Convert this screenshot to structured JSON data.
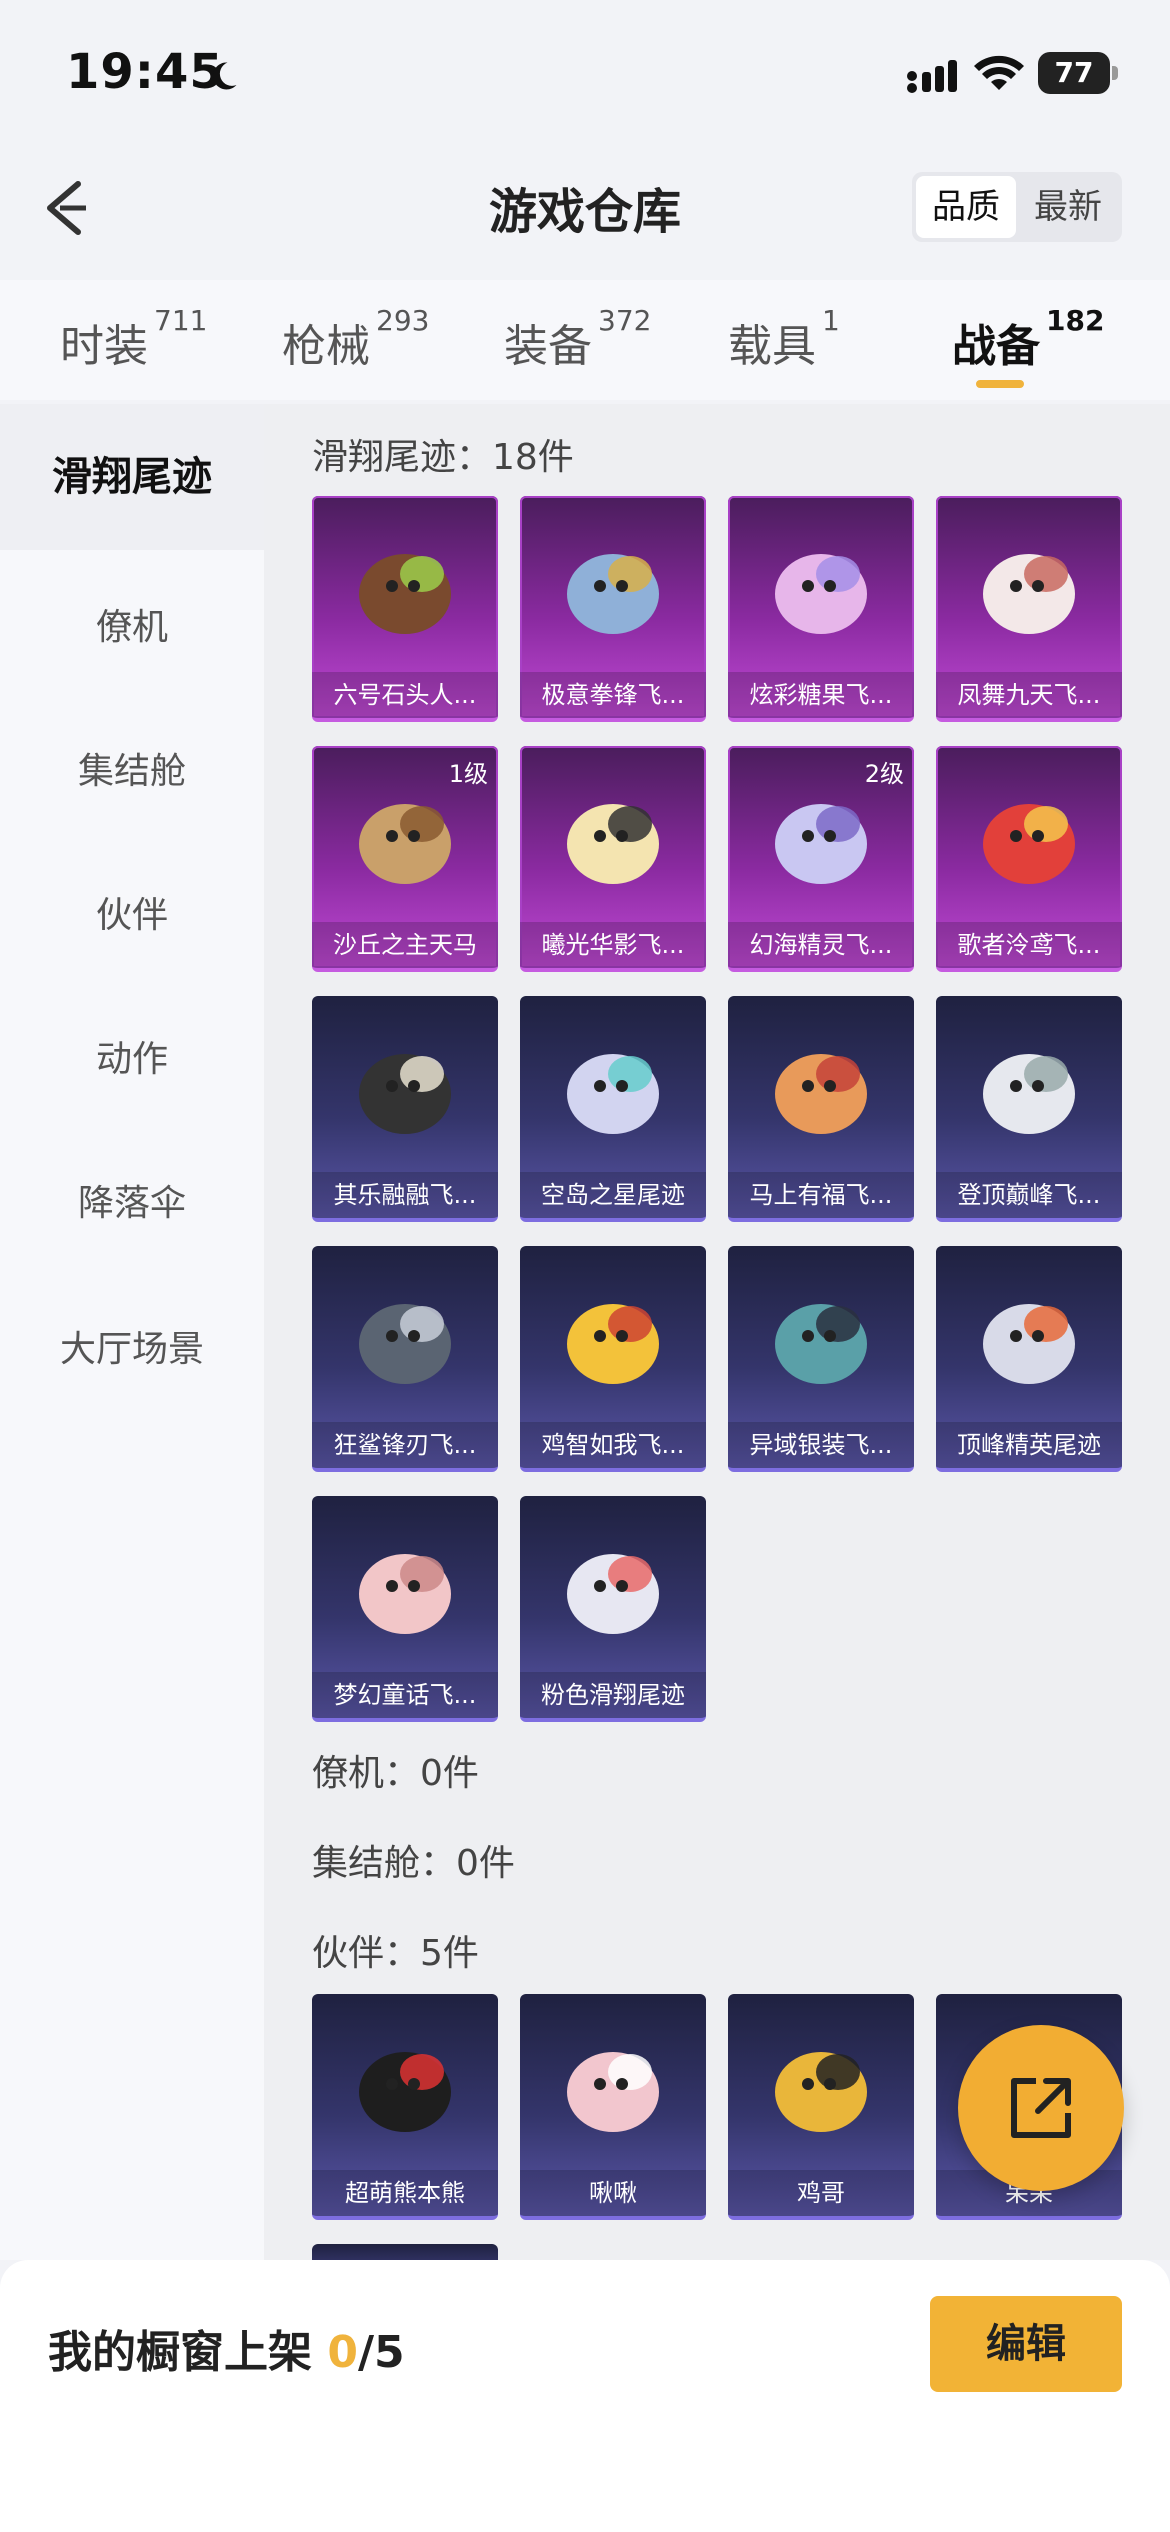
{
  "status": {
    "time": "19:45",
    "battery": "77"
  },
  "header": {
    "title": "游戏仓库",
    "sort": {
      "active": "品质",
      "other": "最新"
    }
  },
  "tabs": [
    {
      "label": "时装",
      "count": "711"
    },
    {
      "label": "枪械",
      "count": "293"
    },
    {
      "label": "装备",
      "count": "372"
    },
    {
      "label": "载具",
      "count": "1"
    },
    {
      "label": "战备",
      "count": "182"
    }
  ],
  "sidebar": {
    "items": [
      "滑翔尾迹",
      "僚机",
      "集结舱",
      "伙伴",
      "动作",
      "降落伞",
      "大厅场景"
    ]
  },
  "sections": {
    "glide": {
      "title": "滑翔尾迹：18件",
      "items": [
        {
          "name": "六号石头人...",
          "tier": "purple",
          "icon": "stone-sprout-icon",
          "level": ""
        },
        {
          "name": "极意拳锋飞...",
          "tier": "purple",
          "icon": "elephant-boxer-icon",
          "level": ""
        },
        {
          "name": "炫彩糖果飞...",
          "tier": "purple",
          "icon": "candy-icon",
          "level": ""
        },
        {
          "name": "凤舞九天飞...",
          "tier": "purple",
          "icon": "phoenix-icon",
          "level": ""
        },
        {
          "name": "沙丘之主天马",
          "tier": "purple",
          "icon": "pegasus-icon",
          "level": "1级"
        },
        {
          "name": "曦光华影飞...",
          "tier": "purple",
          "icon": "flower-icon",
          "level": ""
        },
        {
          "name": "幻海精灵飞...",
          "tier": "purple",
          "icon": "jellyfish-icon",
          "level": "2级"
        },
        {
          "name": "歌者泠鸢飞...",
          "tier": "purple",
          "icon": "bird-icon",
          "level": ""
        },
        {
          "name": "其乐融融飞...",
          "tier": "blue",
          "icon": "penguin-icon",
          "level": ""
        },
        {
          "name": "空岛之星尾迹",
          "tier": "blue",
          "icon": "rainbow-trail-icon",
          "level": ""
        },
        {
          "name": "马上有福飞...",
          "tier": "blue",
          "icon": "horse-toy-icon",
          "level": ""
        },
        {
          "name": "登顶巅峰飞...",
          "tier": "blue",
          "icon": "jet-icon",
          "level": ""
        },
        {
          "name": "狂鲨锋刃飞...",
          "tier": "blue",
          "icon": "shark-icon",
          "level": ""
        },
        {
          "name": "鸡智如我飞...",
          "tier": "blue",
          "icon": "chicken-icon",
          "level": ""
        },
        {
          "name": "异域银装飞...",
          "tier": "blue",
          "icon": "silver-wing-icon",
          "level": ""
        },
        {
          "name": "顶峰精英尾迹",
          "tier": "blue",
          "icon": "flame-trail-icon",
          "level": ""
        },
        {
          "name": "梦幻童话飞...",
          "tier": "blue",
          "icon": "crown-bed-icon",
          "level": ""
        },
        {
          "name": "粉色滑翔尾迹",
          "tier": "blue",
          "icon": "pink-trail-icon",
          "level": ""
        }
      ]
    },
    "wingman": {
      "title": "僚机：0件"
    },
    "capsule": {
      "title": "集结舱：0件"
    },
    "partner": {
      "title": "伙伴：5件",
      "items": [
        {
          "name": "超萌熊本熊",
          "tier": "blue",
          "icon": "bear-icon",
          "level": ""
        },
        {
          "name": "啾啾",
          "tier": "blue",
          "icon": "pink-chick-icon",
          "level": ""
        },
        {
          "name": "鸡哥",
          "tier": "blue",
          "icon": "cool-chicken-icon",
          "level": ""
        },
        {
          "name": "呆呆",
          "tier": "blue",
          "icon": "partner-icon",
          "level": ""
        }
      ]
    }
  },
  "bottom": {
    "label": "我的橱窗上架 ",
    "count": "0",
    "total": "/5",
    "edit": "编辑"
  }
}
